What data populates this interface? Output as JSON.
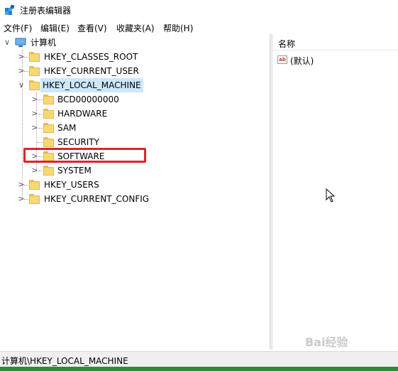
{
  "window": {
    "title": "注册表编辑器"
  },
  "menu": [
    {
      "label": "文件(F)"
    },
    {
      "label": "编辑(E)"
    },
    {
      "label": "查看(V)"
    },
    {
      "label": "收藏夹(A)"
    },
    {
      "label": "帮助(H)"
    }
  ],
  "tree": {
    "root": "计算机",
    "hives": [
      "HKEY_CLASSES_ROOT",
      "HKEY_CURRENT_USER",
      "HKEY_LOCAL_MACHINE",
      "HKEY_USERS",
      "HKEY_CURRENT_CONFIG"
    ],
    "local_machine_children": [
      "BCD00000000",
      "HARDWARE",
      "SAM",
      "SECURITY",
      "SOFTWARE",
      "SYSTEM"
    ],
    "expander_collapsed": ">",
    "expander_expanded": "∨"
  },
  "list": {
    "column_name": "名称",
    "rows": [
      {
        "name": "(默认)",
        "icon": "ab-string-icon"
      }
    ]
  },
  "status": {
    "path": "计算机\\HKEY_LOCAL_MACHINE"
  },
  "watermark": "Bai经验",
  "colors": {
    "highlight": "#e0232c",
    "selected": "#cce8ff",
    "folder": "#f8d775"
  }
}
